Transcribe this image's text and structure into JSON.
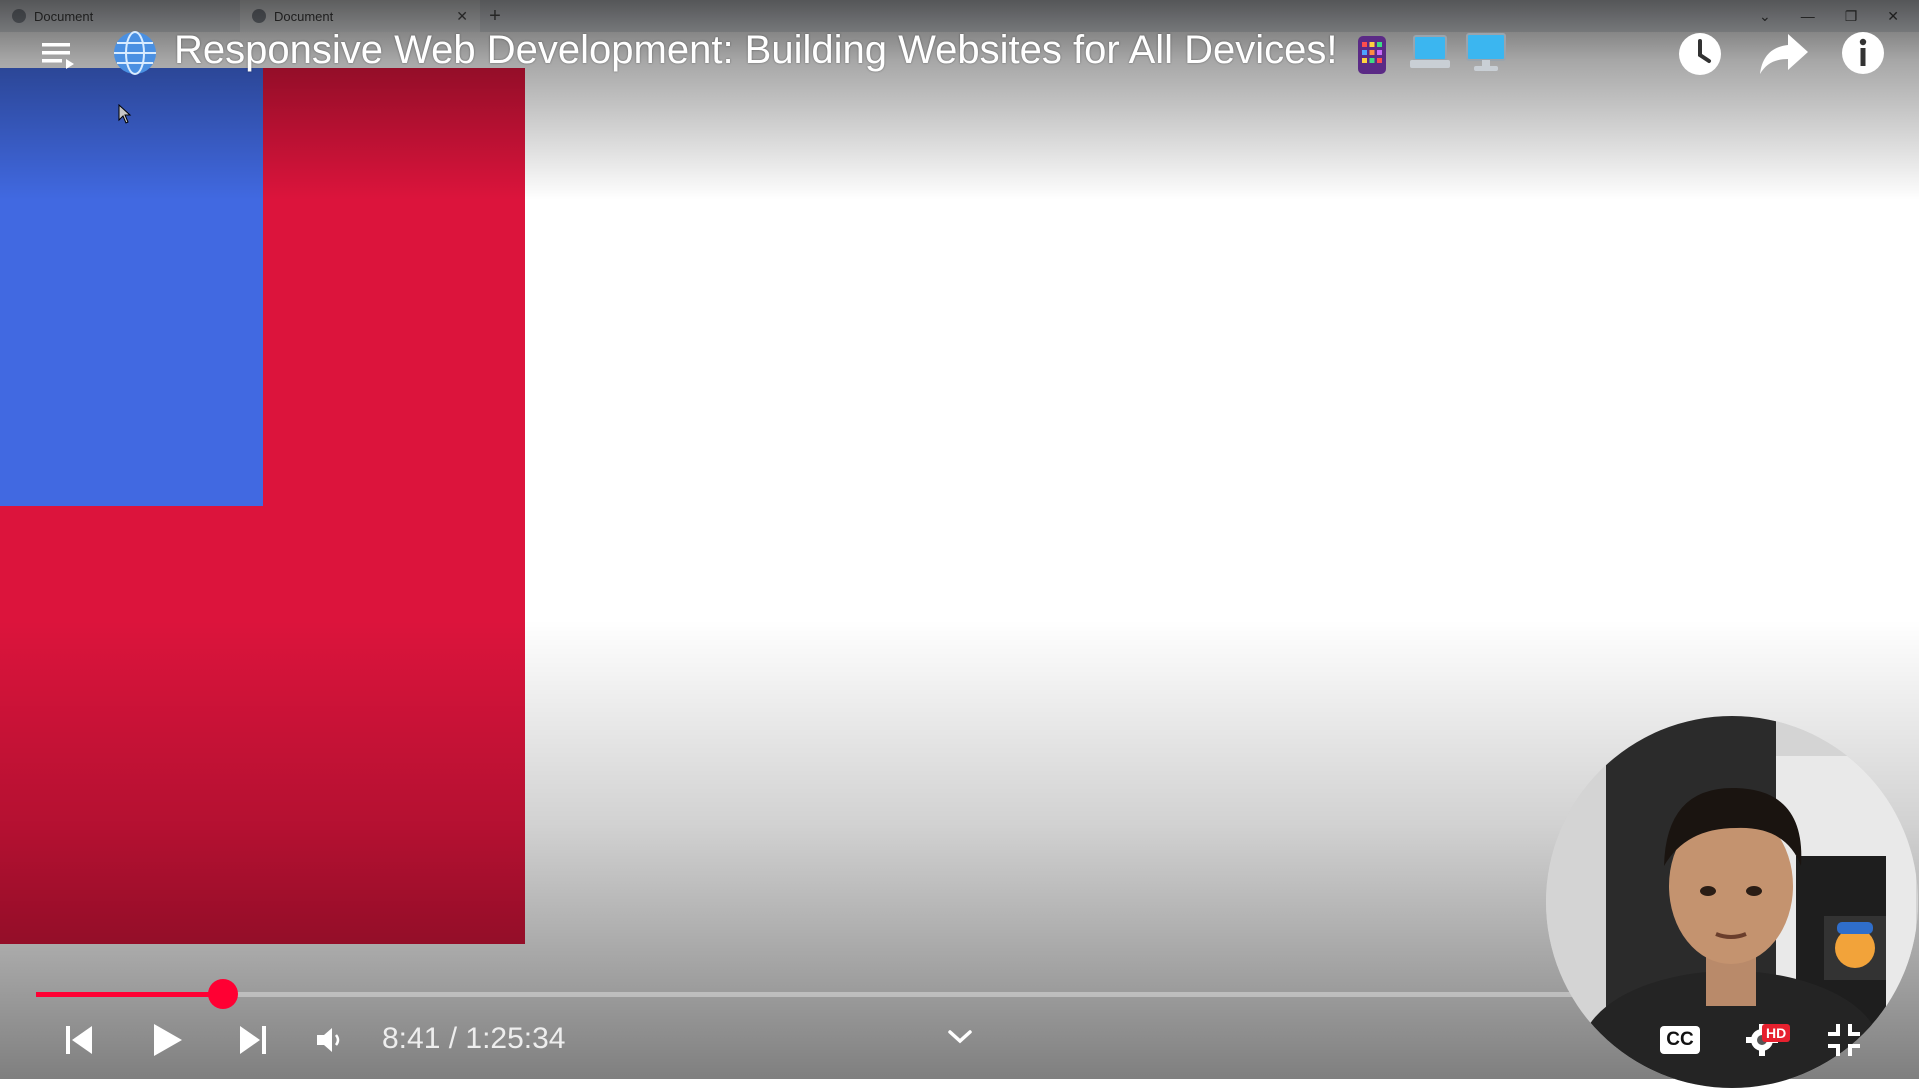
{
  "browser": {
    "tabs": [
      {
        "label": "Document",
        "active": false
      },
      {
        "label": "Document",
        "active": true
      }
    ]
  },
  "page": {
    "colors": {
      "red_box": "#dc143c",
      "blue_box": "#4169e1"
    }
  },
  "video": {
    "title": "Responsive Web Development: Building Websites for All Devices!",
    "title_icons": [
      "globe-icon",
      "app-grid-icon",
      "laptop-icon",
      "desktop-icon"
    ],
    "time_display": "8:41 / 1:25:34",
    "current_time": "8:41",
    "duration": "1:25:34",
    "progress_fraction": 0.1013,
    "accent": "#ff0033",
    "badges": {
      "cc": "CC",
      "hd": "HD"
    }
  }
}
